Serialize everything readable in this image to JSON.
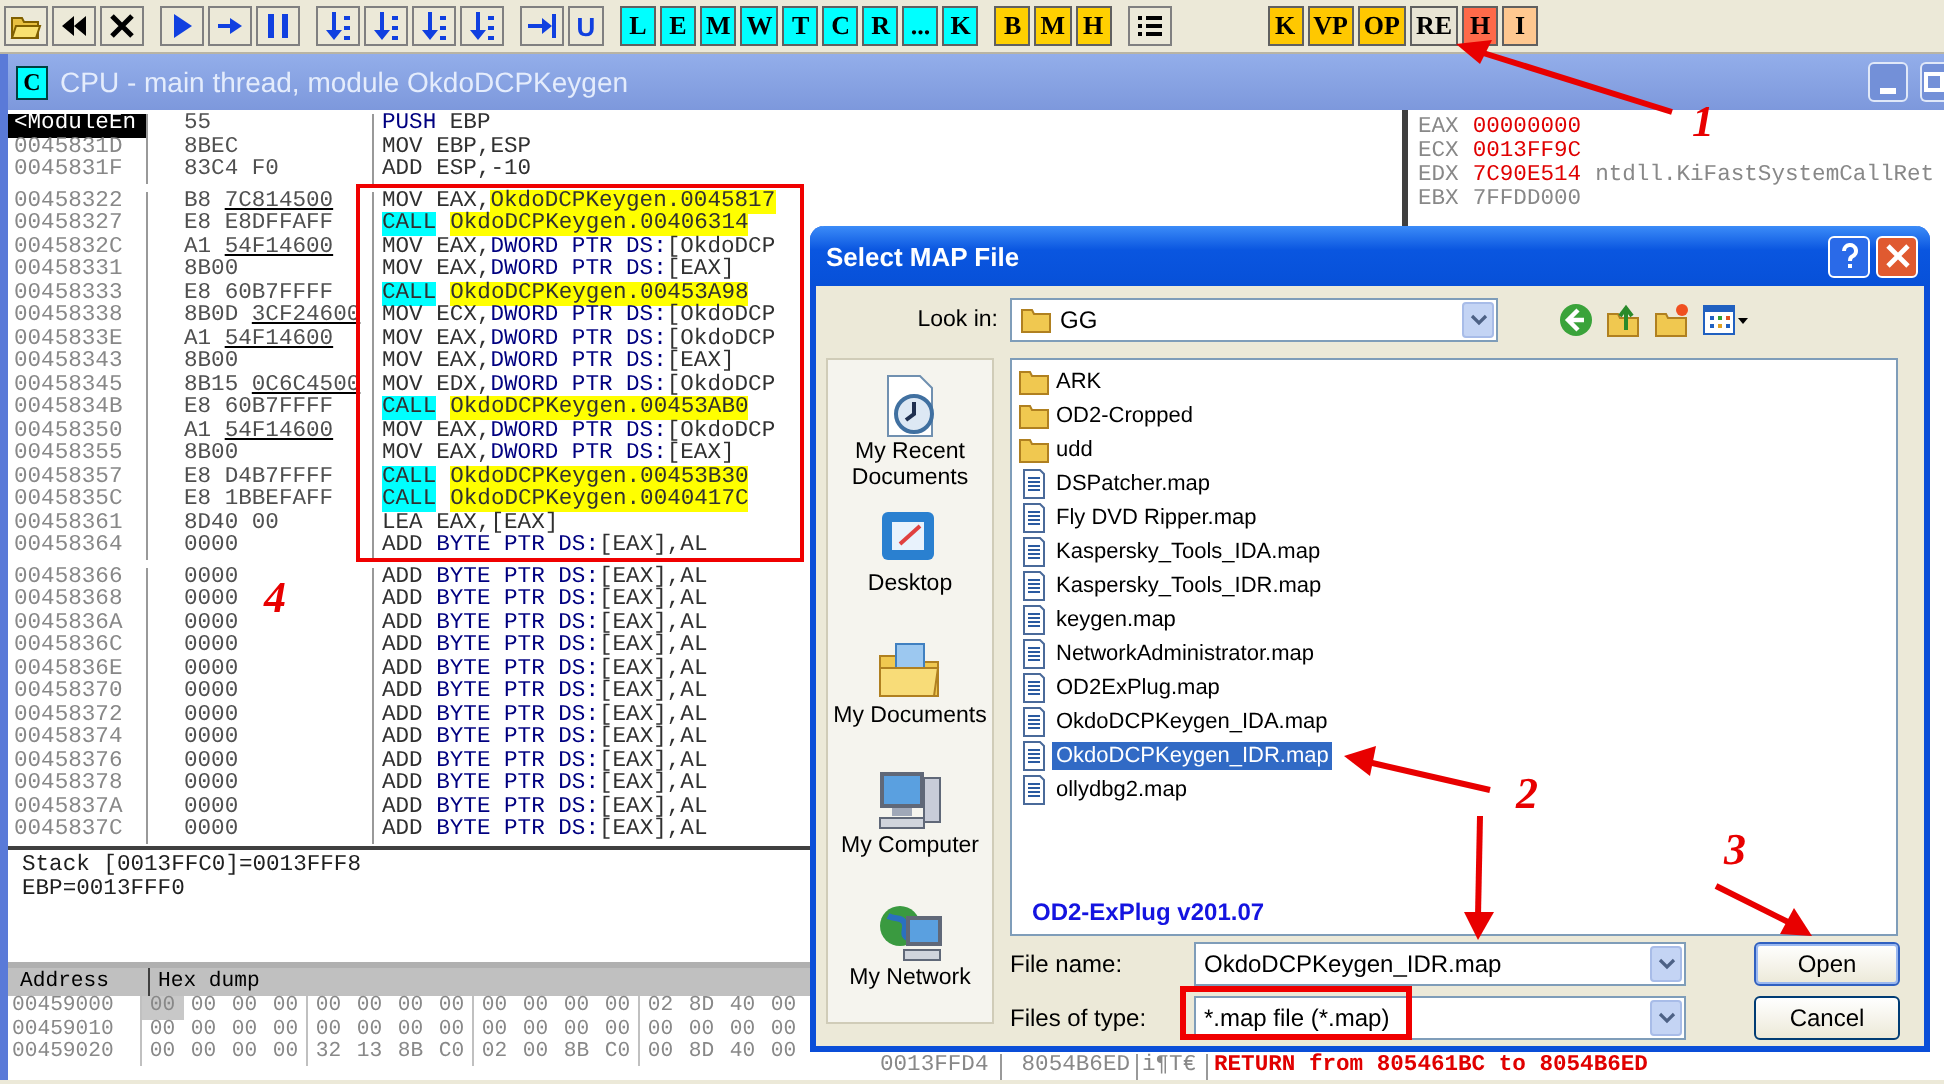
{
  "toolbar": {
    "groups": [
      {
        "buttons": [
          {
            "kind": "open"
          },
          {
            "kind": "rewind"
          },
          {
            "kind": "close"
          }
        ]
      },
      {
        "buttons": [
          {
            "kind": "run"
          },
          {
            "kind": "step"
          },
          {
            "kind": "pause"
          }
        ]
      },
      {
        "buttons": [
          {
            "kind": "trace"
          },
          {
            "kind": "trace"
          },
          {
            "kind": "trace"
          },
          {
            "kind": "trace"
          }
        ]
      },
      {
        "buttons": [
          {
            "kind": "return"
          },
          {
            "kind": "glyph",
            "label": "U"
          }
        ]
      },
      {
        "buttons": [
          {
            "kind": "letter",
            "label": "L",
            "color": "#00ffff"
          },
          {
            "kind": "letter",
            "label": "E",
            "color": "#00ffff"
          },
          {
            "kind": "letter",
            "label": "M",
            "color": "#00ffff"
          },
          {
            "kind": "letter",
            "label": "W",
            "color": "#00ffff"
          },
          {
            "kind": "letter",
            "label": "T",
            "color": "#00ffff"
          },
          {
            "kind": "letter",
            "label": "C",
            "color": "#00ffff"
          },
          {
            "kind": "letter",
            "label": "R",
            "color": "#00ffff"
          },
          {
            "kind": "letter",
            "label": "...",
            "color": "#00ffff"
          },
          {
            "kind": "letter",
            "label": "K",
            "color": "#00ffff"
          }
        ]
      },
      {
        "buttons": [
          {
            "kind": "letter",
            "label": "B",
            "color": "#ffd000"
          },
          {
            "kind": "letter",
            "label": "M",
            "color": "#ffd000"
          },
          {
            "kind": "letter",
            "label": "H",
            "color": "#ffd000"
          }
        ]
      },
      {
        "buttons": [
          {
            "kind": "list"
          }
        ]
      },
      {
        "buttons": [
          {
            "kind": "letter",
            "label": "K",
            "color": "#ffc800"
          },
          {
            "kind": "letter",
            "label": "VP",
            "color": "#ffc800"
          },
          {
            "kind": "letter",
            "label": "OP",
            "color": "#ffc800"
          },
          {
            "kind": "letter",
            "label": "RE",
            "color": "#e8e4d4"
          },
          {
            "kind": "letter",
            "label": "H",
            "color": "#ff6a4a"
          },
          {
            "kind": "letter",
            "label": "I",
            "color": "#ffc890"
          }
        ]
      }
    ]
  },
  "window": {
    "icon_letter": "C",
    "title": "CPU - main thread, module OkdoDCPKeygen"
  },
  "disasm": {
    "rows": [
      {
        "address": "<ModuleEn",
        "current": true,
        "hex": "55",
        "fixup": false,
        "asm": [
          {
            "text": "PUSH",
            "kind": "blue"
          },
          {
            "text": " EBP",
            "kind": "plain"
          }
        ]
      },
      {
        "address": "0045831D",
        "current": false,
        "hex": "8BEC",
        "fixup": false,
        "asm": [
          {
            "text": "MOV EBP,ESP",
            "kind": "plain"
          }
        ]
      },
      {
        "address": "0045831F",
        "current": false,
        "hex": "83C4 F0",
        "fixup": false,
        "asm": [
          {
            "text": "ADD ESP,-10",
            "kind": "plain"
          }
        ]
      },
      {
        "address": "00458322",
        "current": false,
        "hex": "B8 7C814500",
        "fixup": true,
        "asm": [
          {
            "text": "MOV EAX,",
            "kind": "plain"
          },
          {
            "text": "OkdoDCPKeygen.0045817",
            "kind": "label"
          }
        ]
      },
      {
        "address": "00458327",
        "current": false,
        "hex": "E8 E8DFFAFF",
        "fixup": false,
        "asm": [
          {
            "text": "CALL",
            "kind": "call"
          },
          {
            "text": "OkdoDCPKeygen.00406314",
            "kind": "label"
          }
        ]
      },
      {
        "address": "0045832C",
        "current": false,
        "hex": "A1 54F14600",
        "fixup": true,
        "asm": [
          {
            "text": "MOV EAX,",
            "kind": "plain"
          },
          {
            "text": "DWORD PTR DS:",
            "kind": "blue"
          },
          {
            "text": "[OkdoDCP",
            "kind": "plain"
          }
        ]
      },
      {
        "address": "00458331",
        "current": false,
        "hex": "8B00",
        "fixup": false,
        "asm": [
          {
            "text": "MOV EAX,",
            "kind": "plain"
          },
          {
            "text": "DWORD PTR DS:",
            "kind": "blue"
          },
          {
            "text": "[EAX]",
            "kind": "plain"
          }
        ]
      },
      {
        "address": "00458333",
        "current": false,
        "hex": "E8 60B7FFFF",
        "fixup": false,
        "asm": [
          {
            "text": "CALL",
            "kind": "call"
          },
          {
            "text": "OkdoDCPKeygen.00453A98",
            "kind": "label"
          }
        ]
      },
      {
        "address": "00458338",
        "current": false,
        "hex": "8B0D 3CF24600",
        "fixup": true,
        "asm": [
          {
            "text": "MOV ECX,",
            "kind": "plain"
          },
          {
            "text": "DWORD PTR DS:",
            "kind": "blue"
          },
          {
            "text": "[OkdoDCP",
            "kind": "plain"
          }
        ]
      },
      {
        "address": "0045833E",
        "current": false,
        "hex": "A1 54F14600",
        "fixup": true,
        "asm": [
          {
            "text": "MOV EAX,",
            "kind": "plain"
          },
          {
            "text": "DWORD PTR DS:",
            "kind": "blue"
          },
          {
            "text": "[OkdoDCP",
            "kind": "plain"
          }
        ]
      },
      {
        "address": "00458343",
        "current": false,
        "hex": "8B00",
        "fixup": false,
        "asm": [
          {
            "text": "MOV EAX,",
            "kind": "plain"
          },
          {
            "text": "DWORD PTR DS:",
            "kind": "blue"
          },
          {
            "text": "[EAX]",
            "kind": "plain"
          }
        ]
      },
      {
        "address": "00458345",
        "current": false,
        "hex": "8B15 0C6C4500",
        "fixup": true,
        "asm": [
          {
            "text": "MOV EDX,",
            "kind": "plain"
          },
          {
            "text": "DWORD PTR DS:",
            "kind": "blue"
          },
          {
            "text": "[OkdoDCP",
            "kind": "plain"
          }
        ]
      },
      {
        "address": "0045834B",
        "current": false,
        "hex": "E8 60B7FFFF",
        "fixup": false,
        "asm": [
          {
            "text": "CALL",
            "kind": "call"
          },
          {
            "text": "OkdoDCPKeygen.00453AB0",
            "kind": "label"
          }
        ]
      },
      {
        "address": "00458350",
        "current": false,
        "hex": "A1 54F14600",
        "fixup": true,
        "asm": [
          {
            "text": "MOV EAX,",
            "kind": "plain"
          },
          {
            "text": "DWORD PTR DS:",
            "kind": "blue"
          },
          {
            "text": "[OkdoDCP",
            "kind": "plain"
          }
        ]
      },
      {
        "address": "00458355",
        "current": false,
        "hex": "8B00",
        "fixup": false,
        "asm": [
          {
            "text": "MOV EAX,",
            "kind": "plain"
          },
          {
            "text": "DWORD PTR DS:",
            "kind": "blue"
          },
          {
            "text": "[EAX]",
            "kind": "plain"
          }
        ]
      },
      {
        "address": "00458357",
        "current": false,
        "hex": "E8 D4B7FFFF",
        "fixup": false,
        "asm": [
          {
            "text": "CALL",
            "kind": "call"
          },
          {
            "text": "OkdoDCPKeygen.00453B30",
            "kind": "label"
          }
        ]
      },
      {
        "address": "0045835C",
        "current": false,
        "hex": "E8 1BBEFAFF",
        "fixup": false,
        "asm": [
          {
            "text": "CALL",
            "kind": "call"
          },
          {
            "text": "OkdoDCPKeygen.0040417C",
            "kind": "label"
          }
        ]
      },
      {
        "address": "00458361",
        "current": false,
        "hex": "8D40 00",
        "fixup": false,
        "asm": [
          {
            "text": "LEA EAX,[EAX]",
            "kind": "plain"
          }
        ]
      },
      {
        "address": "00458364",
        "current": false,
        "hex": "0000",
        "fixup": false,
        "asm": [
          {
            "text": "ADD ",
            "kind": "plain"
          },
          {
            "text": "BYTE PTR DS:",
            "kind": "blue"
          },
          {
            "text": "[EAX],AL",
            "kind": "plain"
          }
        ]
      },
      {
        "address": "00458366",
        "current": false,
        "hex": "0000",
        "fixup": false,
        "asm": [
          {
            "text": "ADD ",
            "kind": "plain"
          },
          {
            "text": "BYTE PTR DS:",
            "kind": "blue"
          },
          {
            "text": "[EAX],AL",
            "kind": "plain"
          }
        ]
      },
      {
        "address": "00458368",
        "current": false,
        "hex": "0000",
        "fixup": false,
        "asm": [
          {
            "text": "ADD ",
            "kind": "plain"
          },
          {
            "text": "BYTE PTR DS:",
            "kind": "blue"
          },
          {
            "text": "[EAX],AL",
            "kind": "plain"
          }
        ]
      },
      {
        "address": "0045836A",
        "current": false,
        "hex": "0000",
        "fixup": false,
        "asm": [
          {
            "text": "ADD ",
            "kind": "plain"
          },
          {
            "text": "BYTE PTR DS:",
            "kind": "blue"
          },
          {
            "text": "[EAX],AL",
            "kind": "plain"
          }
        ]
      },
      {
        "address": "0045836C",
        "current": false,
        "hex": "0000",
        "fixup": false,
        "asm": [
          {
            "text": "ADD ",
            "kind": "plain"
          },
          {
            "text": "BYTE PTR DS:",
            "kind": "blue"
          },
          {
            "text": "[EAX],AL",
            "kind": "plain"
          }
        ]
      },
      {
        "address": "0045836E",
        "current": false,
        "hex": "0000",
        "fixup": false,
        "asm": [
          {
            "text": "ADD ",
            "kind": "plain"
          },
          {
            "text": "BYTE PTR DS:",
            "kind": "blue"
          },
          {
            "text": "[EAX],AL",
            "kind": "plain"
          }
        ]
      },
      {
        "address": "00458370",
        "current": false,
        "hex": "0000",
        "fixup": false,
        "asm": [
          {
            "text": "ADD ",
            "kind": "plain"
          },
          {
            "text": "BYTE PTR DS:",
            "kind": "blue"
          },
          {
            "text": "[EAX],AL",
            "kind": "plain"
          }
        ]
      },
      {
        "address": "00458372",
        "current": false,
        "hex": "0000",
        "fixup": false,
        "asm": [
          {
            "text": "ADD ",
            "kind": "plain"
          },
          {
            "text": "BYTE PTR DS:",
            "kind": "blue"
          },
          {
            "text": "[EAX],AL",
            "kind": "plain"
          }
        ]
      },
      {
        "address": "00458374",
        "current": false,
        "hex": "0000",
        "fixup": false,
        "asm": [
          {
            "text": "ADD ",
            "kind": "plain"
          },
          {
            "text": "BYTE PTR DS:",
            "kind": "blue"
          },
          {
            "text": "[EAX],AL",
            "kind": "plain"
          }
        ]
      },
      {
        "address": "00458376",
        "current": false,
        "hex": "0000",
        "fixup": false,
        "asm": [
          {
            "text": "ADD ",
            "kind": "plain"
          },
          {
            "text": "BYTE PTR DS:",
            "kind": "blue"
          },
          {
            "text": "[EAX],AL",
            "kind": "plain"
          }
        ]
      },
      {
        "address": "00458378",
        "current": false,
        "hex": "0000",
        "fixup": false,
        "asm": [
          {
            "text": "ADD ",
            "kind": "plain"
          },
          {
            "text": "BYTE PTR DS:",
            "kind": "blue"
          },
          {
            "text": "[EAX],AL",
            "kind": "plain"
          }
        ]
      },
      {
        "address": "0045837A",
        "current": false,
        "hex": "0000",
        "fixup": false,
        "asm": [
          {
            "text": "ADD ",
            "kind": "plain"
          },
          {
            "text": "BYTE PTR DS:",
            "kind": "blue"
          },
          {
            "text": "[EAX],AL",
            "kind": "plain"
          }
        ]
      },
      {
        "address": "0045837C",
        "current": false,
        "hex": "0000",
        "fixup": false,
        "asm": [
          {
            "text": "ADD ",
            "kind": "plain"
          },
          {
            "text": "BYTE PTR DS:",
            "kind": "blue"
          },
          {
            "text": "[EAX],AL",
            "kind": "plain"
          }
        ]
      }
    ]
  },
  "registers": [
    {
      "name": "EAX",
      "value": "00000000",
      "changed": true
    },
    {
      "name": "ECX",
      "value": "0013FF9C",
      "changed": true
    },
    {
      "name": "EDX",
      "value": "7C90E514",
      "changed": true,
      "comment": "ntdll.KiFastSystemCallRet"
    },
    {
      "name": "EBX",
      "value": "7FFDD000",
      "changed": false
    }
  ],
  "info": [
    "Stack [0013FFC0]=0013FFF8",
    "EBP=0013FFF0"
  ],
  "dump": {
    "columns": [
      "Address",
      "Hex dump"
    ],
    "rows": [
      {
        "address": "00459000",
        "bytes": [
          {
            "text": "00",
            "selected": true
          },
          {
            "text": "00",
            "selected": false
          },
          {
            "text": "00",
            "selected": false
          },
          {
            "text": "00",
            "selected": false
          },
          {
            "text": "00",
            "selected": false
          },
          {
            "text": "00",
            "selected": false
          },
          {
            "text": "00",
            "selected": false
          },
          {
            "text": "00",
            "selected": false
          },
          {
            "text": "00",
            "selected": false
          },
          {
            "text": "00",
            "selected": false
          },
          {
            "text": "00",
            "selected": false
          },
          {
            "text": "00",
            "selected": false
          },
          {
            "text": "02",
            "selected": false
          },
          {
            "text": "8D",
            "selected": false
          },
          {
            "text": "40",
            "selected": false
          },
          {
            "text": "00",
            "selected": false
          }
        ]
      },
      {
        "address": "00459010",
        "bytes": [
          {
            "text": "00",
            "selected": false
          },
          {
            "text": "00",
            "selected": false
          },
          {
            "text": "00",
            "selected": false
          },
          {
            "text": "00",
            "selected": false
          },
          {
            "text": "00",
            "selected": false
          },
          {
            "text": "00",
            "selected": false
          },
          {
            "text": "00",
            "selected": false
          },
          {
            "text": "00",
            "selected": false
          },
          {
            "text": "00",
            "selected": false
          },
          {
            "text": "00",
            "selected": false
          },
          {
            "text": "00",
            "selected": false
          },
          {
            "text": "00",
            "selected": false
          },
          {
            "text": "00",
            "selected": false
          },
          {
            "text": "00",
            "selected": false
          },
          {
            "text": "00",
            "selected": false
          },
          {
            "text": "00",
            "selected": false
          }
        ]
      },
      {
        "address": "00459020",
        "bytes": [
          {
            "text": "00",
            "selected": false
          },
          {
            "text": "00",
            "selected": false
          },
          {
            "text": "00",
            "selected": false
          },
          {
            "text": "00",
            "selected": false
          },
          {
            "text": "32",
            "selected": false
          },
          {
            "text": "13",
            "selected": false
          },
          {
            "text": "8B",
            "selected": false
          },
          {
            "text": "C0",
            "selected": false
          },
          {
            "text": "02",
            "selected": false
          },
          {
            "text": "00",
            "selected": false
          },
          {
            "text": "8B",
            "selected": false
          },
          {
            "text": "C0",
            "selected": false
          },
          {
            "text": "00",
            "selected": false
          },
          {
            "text": "8D",
            "selected": false
          },
          {
            "text": "40",
            "selected": false
          },
          {
            "text": "00",
            "selected": false
          }
        ]
      }
    ]
  },
  "stack": [
    {
      "address": "0013FFD4",
      "value": "8054B6ED",
      "ascii": "i¶T€",
      "comment": "RETURN from 805461BC to 8054B6ED"
    }
  ],
  "dialog": {
    "title": "Select MAP File",
    "look_in_label": "Look in:",
    "look_in_value": "GG",
    "places": [
      {
        "kind": "recent",
        "label": "My Recent Documents"
      },
      {
        "kind": "desktop",
        "label": "Desktop"
      },
      {
        "kind": "documents",
        "label": "My Documents"
      },
      {
        "kind": "computer",
        "label": "My Computer"
      },
      {
        "kind": "network",
        "label": "My Network"
      }
    ],
    "files": [
      {
        "kind": "folder",
        "name": "ARK",
        "selected": false
      },
      {
        "kind": "folder",
        "name": "OD2-Cropped",
        "selected": false
      },
      {
        "kind": "folder",
        "name": "udd",
        "selected": false
      },
      {
        "kind": "file",
        "name": "DSPatcher.map",
        "selected": false
      },
      {
        "kind": "file",
        "name": "Fly DVD Ripper.map",
        "selected": false
      },
      {
        "kind": "file",
        "name": "Kaspersky_Tools_IDA.map",
        "selected": false
      },
      {
        "kind": "file",
        "name": "Kaspersky_Tools_IDR.map",
        "selected": false
      },
      {
        "kind": "file",
        "name": "keygen.map",
        "selected": false
      },
      {
        "kind": "file",
        "name": "NetworkAdministrator.map",
        "selected": false
      },
      {
        "kind": "file",
        "name": "OD2ExPlug.map",
        "selected": false
      },
      {
        "kind": "file",
        "name": "OkdoDCPKeygen_IDA.map",
        "selected": false
      },
      {
        "kind": "file",
        "name": "OkdoDCPKeygen_IDR.map",
        "selected": true
      },
      {
        "kind": "file",
        "name": "ollydbg2.map",
        "selected": false
      }
    ],
    "plugin_label": "OD2-ExPlug v201.07",
    "file_name_label": "File name:",
    "file_name_value": "OkdoDCPKeygen_IDR.map",
    "file_type_label": "Files of type:",
    "file_type_value": "*.map file (*.map)",
    "buttons": [
      "Open",
      "Cancel"
    ]
  },
  "annotations": [
    "1",
    "2",
    "3",
    "4"
  ]
}
